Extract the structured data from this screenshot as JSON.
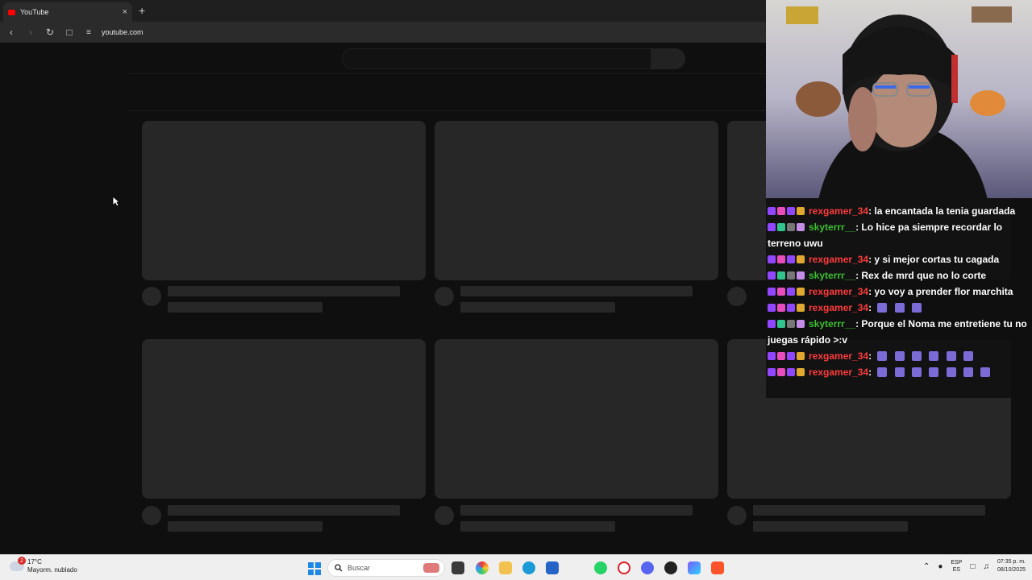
{
  "browser": {
    "tab_title": "YouTube",
    "tab_close": "×",
    "new_tab": "+",
    "url": "youtube.com"
  },
  "chat": {
    "messages": [
      {
        "user": "rexgamer_34",
        "text": ": la encantada la tenia guardada"
      },
      {
        "user": "skyterrr__",
        "text": ": Lo hice pa siempre recordar lo terreno uwu"
      },
      {
        "user": "rexgamer_34",
        "text": ": y si mejor cortas tu cagada"
      },
      {
        "user": "skyterrr__",
        "text": ": Rex de mrd que no lo corte"
      },
      {
        "user": "rexgamer_34",
        "text": ": yo voy a prender flor marchita"
      },
      {
        "user": "rexgamer_34",
        "text": ":"
      },
      {
        "user": "skyterrr__",
        "text": ": Porque el Noma me entretiene tu no juegas rápido >:v"
      },
      {
        "user": "rexgamer_34",
        "text": ":"
      },
      {
        "user": "rexgamer_34",
        "text": ":"
      }
    ]
  },
  "taskbar": {
    "weather_temp": "17°C",
    "weather_desc": "Mayorm. nublado",
    "weather_badge": "2",
    "search_placeholder": "Buscar",
    "lang_top": "ESP",
    "lang_bottom": "ES",
    "time": "07:35 p. m.",
    "date": "08/10/2025"
  }
}
